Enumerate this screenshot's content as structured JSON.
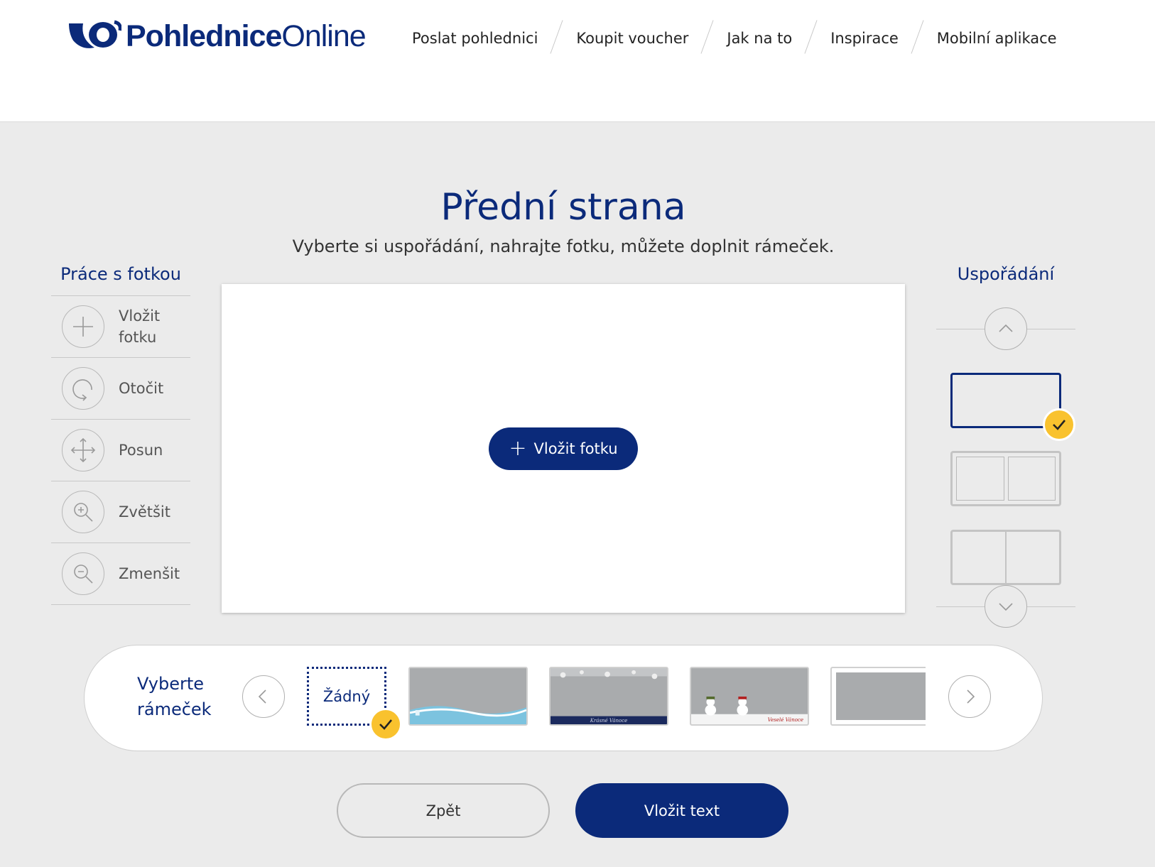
{
  "brand": {
    "name_bold": "Pohlednice",
    "name_light": "Online",
    "color": "#0b2a7a"
  },
  "nav": {
    "items": [
      {
        "label": "Poslat pohlednici"
      },
      {
        "label": "Koupit voucher"
      },
      {
        "label": "Jak na to"
      },
      {
        "label": "Inspirace"
      },
      {
        "label": "Mobilní aplikace"
      }
    ]
  },
  "page": {
    "title": "Přední strana",
    "subtitle": "Vyberte si uspořádání, nahrajte fotku, můžete doplnit rámeček."
  },
  "tools": {
    "title": "Práce s fotkou",
    "items": [
      {
        "label": "Vložit fotku",
        "icon": "plus-icon"
      },
      {
        "label": "Otočit",
        "icon": "rotate-icon"
      },
      {
        "label": "Posun",
        "icon": "move-icon"
      },
      {
        "label": "Zvětšit",
        "icon": "zoom-in-icon"
      },
      {
        "label": "Zmenšit",
        "icon": "zoom-out-icon"
      }
    ]
  },
  "canvas": {
    "insert_label": "Vložit fotku"
  },
  "layouts": {
    "title": "Uspořádání",
    "selected_index": 0
  },
  "frames": {
    "label": "Vyberte rámeček",
    "none_label": "Žádný",
    "thumb_texts": [
      "Krásné Vánoce",
      "Veselé Vánoce"
    ],
    "selected_index": 0
  },
  "buttons": {
    "back": "Zpět",
    "next": "Vložit text"
  },
  "colors": {
    "accent": "#0b2a7a",
    "check": "#f9c22e",
    "background": "#ebebeb"
  }
}
